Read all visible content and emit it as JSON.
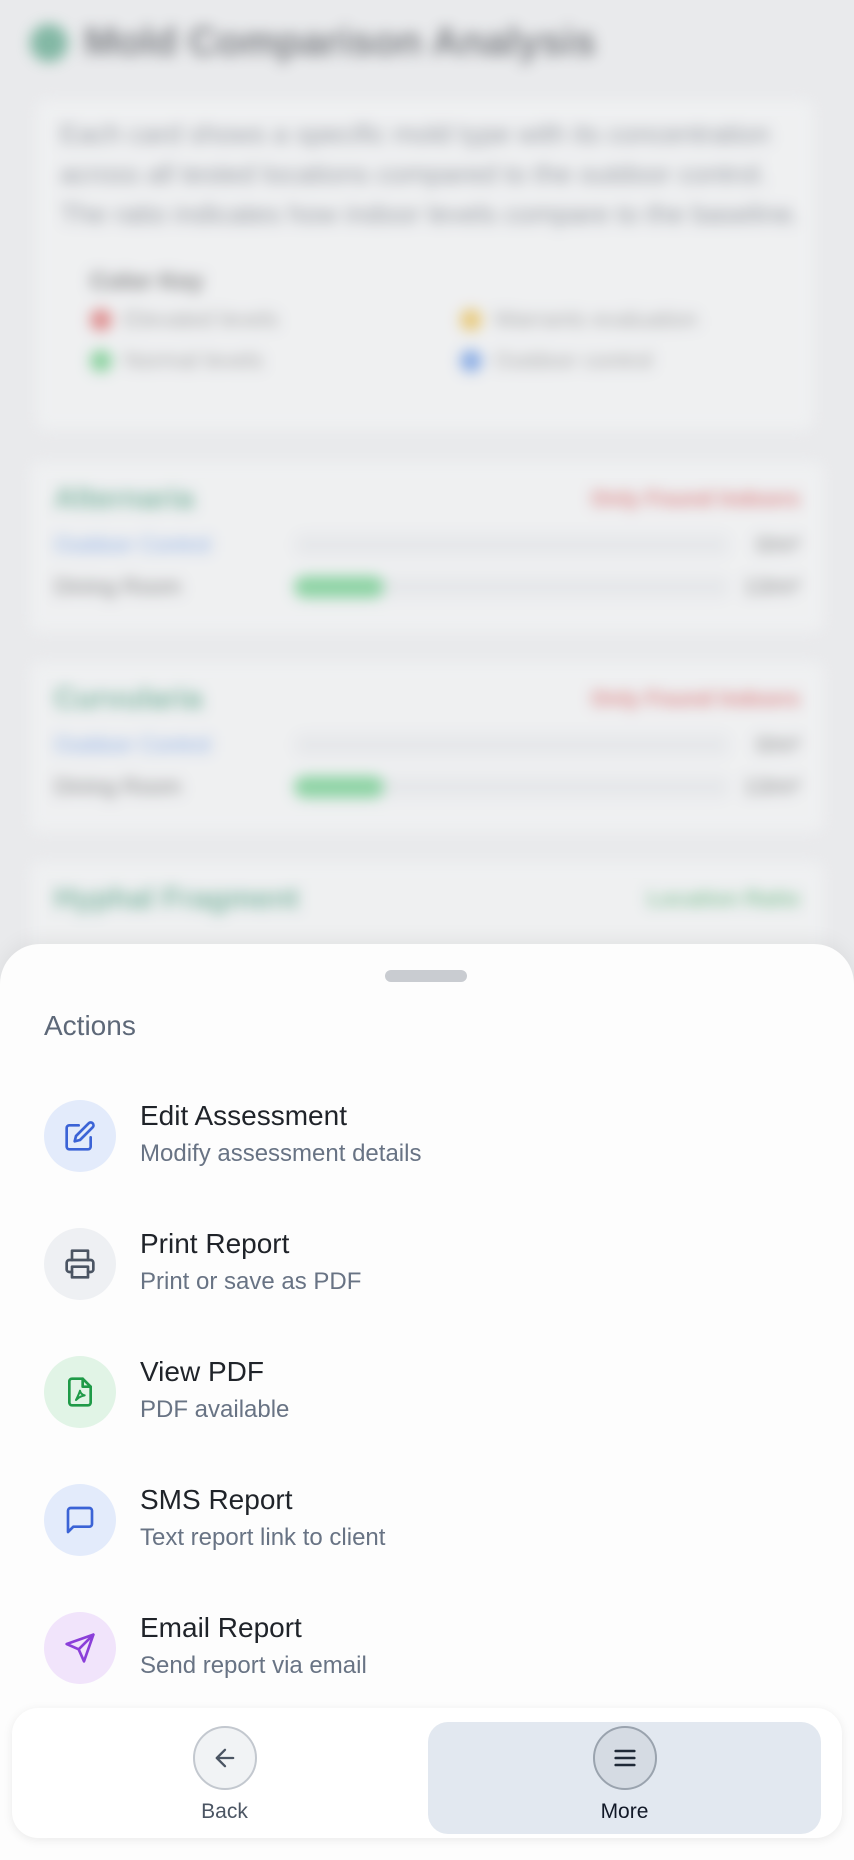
{
  "background": {
    "title": "Mold Comparison Analysis",
    "intro": "Each card shows a specific mold type with its concentration across all tested locations compared to the outdoor control. The ratio indicates how indoor levels compare to the baseline.",
    "color_key": {
      "title": "Color Key",
      "items": [
        {
          "label": "Elevated levels",
          "color": "#d64545"
        },
        {
          "label": "Warrants evaluation",
          "color": "#e8b023"
        },
        {
          "label": "Normal levels",
          "color": "#3cbf5f"
        },
        {
          "label": "Outdoor control",
          "color": "#3d7be0"
        }
      ]
    },
    "cards": [
      {
        "title": "Alternaria",
        "badge": "Only Found Indoors",
        "badge_type": "alert",
        "rows": [
          {
            "label": "Outdoor Control",
            "value": "0/m³"
          },
          {
            "label": "Dining Room",
            "value": "13/m³"
          }
        ]
      },
      {
        "title": "Curvularia",
        "badge": "Only Found Indoors",
        "badge_type": "alert",
        "rows": [
          {
            "label": "Outdoor Control",
            "value": "0/m³"
          },
          {
            "label": "Dining Room",
            "value": "13/m³"
          }
        ]
      },
      {
        "title": "Hyphal Fragment",
        "badge": "Location Ratio",
        "badge_type": "ok",
        "rows": []
      }
    ]
  },
  "sheet": {
    "title": "Actions",
    "actions": [
      {
        "title": "Edit Assessment",
        "subtitle": "Modify assessment details",
        "icon": "edit-icon",
        "bg": "#e3ebfb",
        "fg": "#3b63d6"
      },
      {
        "title": "Print Report",
        "subtitle": "Print or save as PDF",
        "icon": "printer-icon",
        "bg": "#eef0f3",
        "fg": "#4b5563"
      },
      {
        "title": "View PDF",
        "subtitle": "PDF available",
        "icon": "pdf-file-icon",
        "bg": "#e1f4e6",
        "fg": "#1f9a48"
      },
      {
        "title": "SMS Report",
        "subtitle": "Text report link to client",
        "icon": "message-icon",
        "bg": "#e3ebfb",
        "fg": "#3b63d6"
      },
      {
        "title": "Email Report",
        "subtitle": "Send report via email",
        "icon": "send-icon",
        "bg": "#f1e4fb",
        "fg": "#8b3fd9"
      }
    ]
  },
  "nav": {
    "back_label": "Back",
    "more_label": "More"
  }
}
